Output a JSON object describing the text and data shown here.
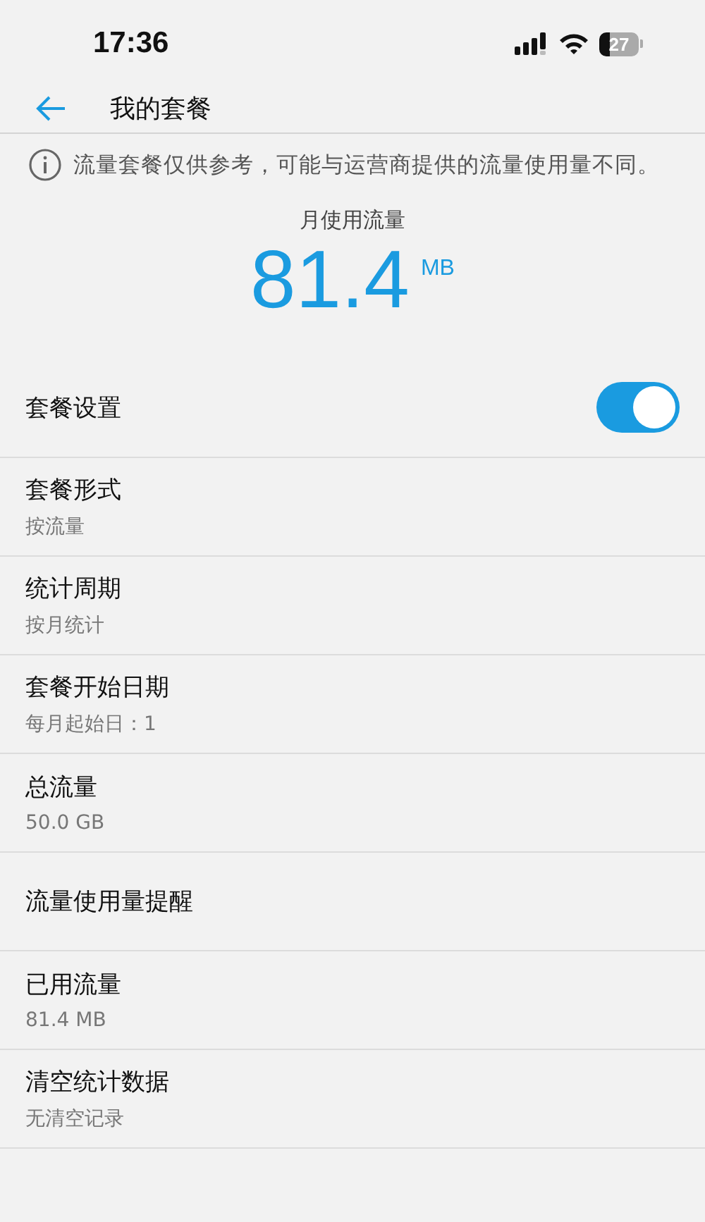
{
  "status_bar": {
    "time": "17:36",
    "battery": "27"
  },
  "header": {
    "title": "我的套餐"
  },
  "notice": "流量套餐仅供参考，可能与运营商提供的流量使用量不同。",
  "usage": {
    "label": "月使用流量",
    "value": "81.4",
    "unit": "MB"
  },
  "settings": [
    {
      "kind": "toggle",
      "title": "套餐设置",
      "on": true
    },
    {
      "kind": "detail",
      "title": "套餐形式",
      "subtitle": "按流量"
    },
    {
      "kind": "detail",
      "title": "统计周期",
      "subtitle": "按月统计"
    },
    {
      "kind": "detail",
      "title": "套餐开始日期",
      "subtitle": "每月起始日：1"
    },
    {
      "kind": "detail",
      "title": "总流量",
      "subtitle": "50.0 GB"
    },
    {
      "kind": "plain",
      "title": "流量使用量提醒"
    },
    {
      "kind": "detail",
      "title": "已用流量",
      "subtitle": "81.4 MB"
    },
    {
      "kind": "detail",
      "title": "清空统计数据",
      "subtitle": "无清空记录"
    }
  ]
}
